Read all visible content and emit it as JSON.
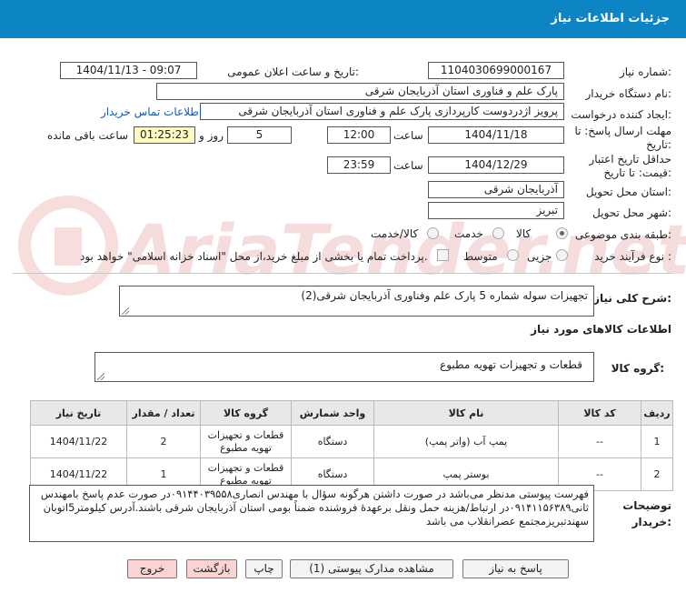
{
  "header": {
    "title": "جزئیات اطلاعات نیاز"
  },
  "fields": {
    "need_number_label": "شماره نیاز:",
    "need_number": "1104030699000167",
    "announce_label": "تاریخ و ساعت اعلان عمومی:",
    "announce_value": "1404/11/13 - 09:07",
    "buyer_label": "نام دستگاه خریدار:",
    "buyer": "پارک علم و فناوری استان آذربایجان شرقی",
    "creator_label": "ایجاد کننده درخواست:",
    "creator": "پرویز اژدردوست کارپردازی پارک علم و فناوری استان آذربایجان شرقی",
    "contact_link": "اطلاعات تماس خریدار",
    "deadline_label": "مهلت ارسال پاسخ: تا تاریخ:",
    "deadline_date": "1404/11/18",
    "time_label": "ساعت",
    "deadline_time": "12:00",
    "days": "5",
    "days_label": "روز و",
    "remaining": "01:25:23",
    "remaining_label": "ساعت باقی مانده",
    "validity_label": "حداقل تاریخ اعتبار قیمت: تا تاریخ:",
    "validity_date": "1404/12/29",
    "validity_time": "23:59",
    "province_label": "استان محل تحویل:",
    "province": "آذربایجان شرقی",
    "city_label": "شهر محل تحویل:",
    "city": "تبریز",
    "category_label": "طبقه بندی موضوعی:",
    "category_options": [
      "کالا",
      "خدمت",
      "کالا/خدمت"
    ],
    "process_label": "نوع فرآیند خرید :",
    "process_options": [
      "جزیی",
      "متوسط"
    ],
    "payment_note": "پرداخت تمام یا بخشی از مبلغ خرید،از محل \"اسناد خزانه اسلامی\" خواهد بود."
  },
  "need": {
    "summary_label": "شرح کلی نیاز:",
    "summary": "تجهیزات سوله شماره 5 پارک علم وفناوری آذربایجان شرقی(2)",
    "goods_info_title": "اطلاعات کالاهای مورد نیاز",
    "goods_group_label": "گروه کالا:",
    "goods_group": "قطعات و تجهیزات تهویه مطبوع"
  },
  "table": {
    "headers": [
      "ردیف",
      "کد کالا",
      "نام کالا",
      "واحد شمارش",
      "گروه کالا",
      "تعداد / مقدار",
      "تاریخ نیاز"
    ],
    "rows": [
      {
        "row": "1",
        "code": "--",
        "name": "پمپ آب (واتر پمپ)",
        "unit": "دستگاه",
        "group": "قطعات و تجهیزات تهویه مطبوع",
        "qty": "2",
        "date": "1404/11/22"
      },
      {
        "row": "2",
        "code": "--",
        "name": "بوستر پمپ",
        "unit": "دستگاه",
        "group": "قطعات و تجهیزات تهویه مطبوع",
        "qty": "1",
        "date": "1404/11/22"
      }
    ]
  },
  "notes": {
    "label": "توضیحات خریدار:",
    "text": "فهرست پیوستی مدنظر می‌باشد در صورت داشتن هرگونه سؤال با مهندس انصاری۰۹۱۴۴۰۳۹۵۵۸در صورت عدم پاسخ بامهندس ثانی۰۹۱۴۱۱۵۶۳۸۹در ارتباط/هزینه حمل ونقل برعهدهٔ فروشنده ضمناً بومی استان آذربایجان شرقی باشند.آدرس کیلومتر5اتوبان سهندتبریزمجتمع عصرانقلاب می باشد"
  },
  "buttons": {
    "reply": "پاسخ به نیاز",
    "attachments": "مشاهده مدارک پیوستی (1)",
    "print": "چاپ",
    "back": "بازگشت",
    "exit": "خروج"
  },
  "watermark": "AriaTender.net",
  "colors": {
    "header": "#0d84c4",
    "timer_bg": "#fff9c4",
    "link": "#1259b8",
    "danger_btn": "#fbd3d3"
  }
}
